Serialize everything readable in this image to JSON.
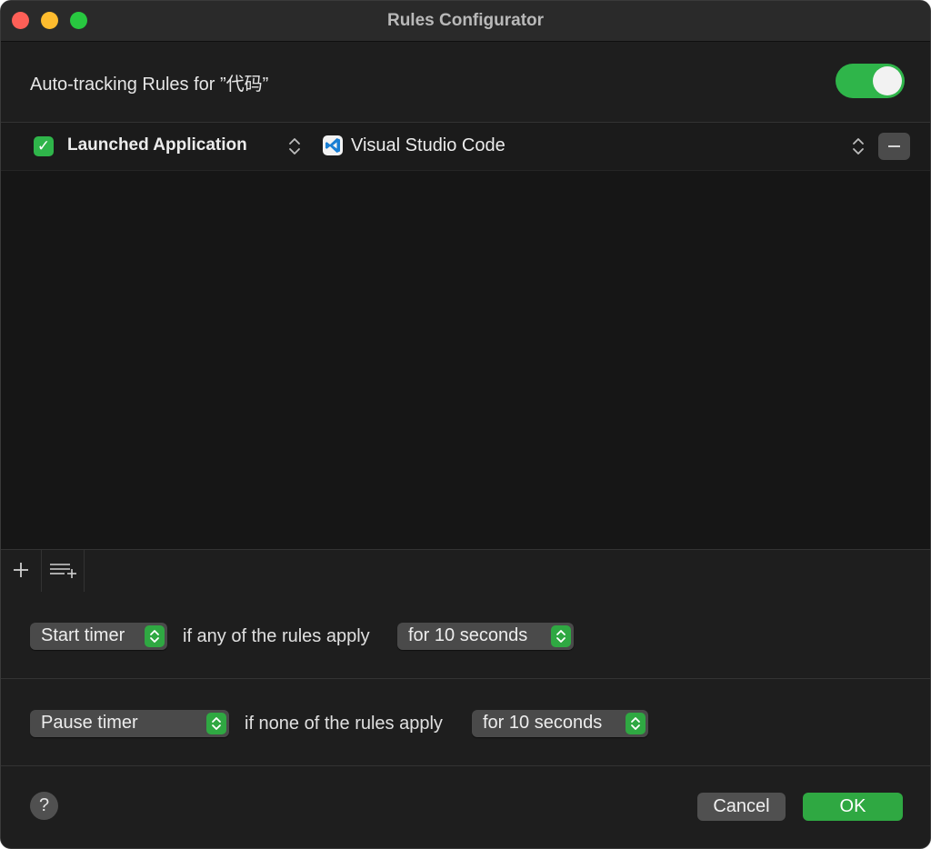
{
  "window": {
    "title": "Rules Configurator"
  },
  "header": {
    "label": "Auto-tracking Rules for ”代码”",
    "toggle_on": true
  },
  "rules": [
    {
      "enabled": true,
      "type": "Launched Application",
      "app_icon": "vscode-icon",
      "value": "Visual Studio Code"
    }
  ],
  "toolbar": {
    "add_icon": "plus-icon",
    "add_group_icon": "add-list-icon"
  },
  "conditions": {
    "start": {
      "action": "Start timer",
      "text": "if any of the rules apply",
      "duration": "for 10 seconds"
    },
    "pause": {
      "action": "Pause timer",
      "text": "if none of the rules apply",
      "duration": "for 10 seconds"
    }
  },
  "footer": {
    "help_label": "?",
    "cancel_label": "Cancel",
    "ok_label": "OK"
  },
  "colors": {
    "accent_green": "#2fa842",
    "window_bg": "#1e1e1e",
    "close": "#fe5f57",
    "minimize": "#febc2e",
    "maximize": "#28c840"
  }
}
